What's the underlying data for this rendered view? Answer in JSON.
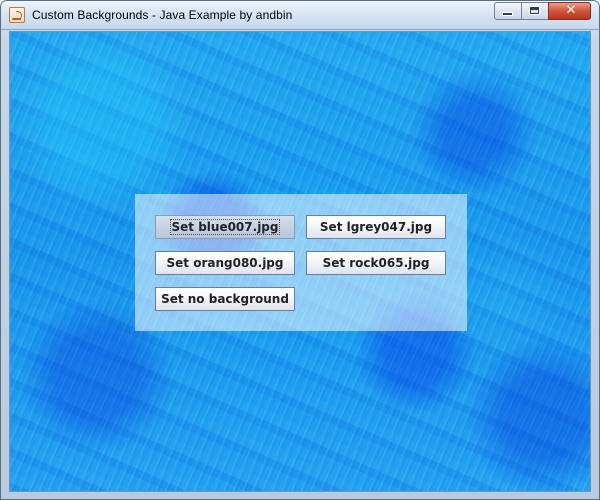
{
  "window": {
    "title": "Custom Backgrounds - Java Example by andbin",
    "icons": {
      "app": "java-icon",
      "minimize": "minimize-icon",
      "maximize": "maximize-icon",
      "close": "close-icon"
    }
  },
  "panel": {
    "buttons": [
      {
        "label": "Set blue007.jpg",
        "selected": true
      },
      {
        "label": "Set lgrey047.jpg"
      },
      {
        "label": "Set orang080.jpg"
      },
      {
        "label": "Set rock065.jpg"
      },
      {
        "label": "Set no background"
      }
    ]
  },
  "colors": {
    "background_primary": "#1595eb",
    "background_dark": "#0038dc",
    "panel_overlay": "#ffffff",
    "button_border": "#6e7d95"
  }
}
